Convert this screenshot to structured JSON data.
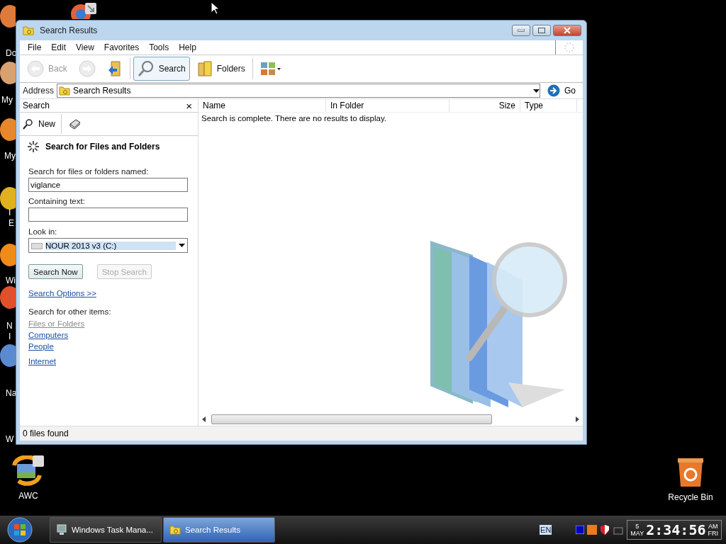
{
  "desktop": {
    "left_labels": [
      {
        "label": "Do"
      },
      {
        "label": "My"
      },
      {
        "label": "My"
      },
      {
        "label": "I"
      },
      {
        "label": "E"
      },
      {
        "label": "Wi"
      },
      {
        "label": "N"
      },
      {
        "label": "I"
      },
      {
        "label": "Na"
      },
      {
        "label": "W"
      }
    ],
    "icons": [
      {
        "label": "AWC",
        "kind": "awc"
      },
      {
        "label": "Recycle Bin",
        "kind": "bin"
      }
    ]
  },
  "window": {
    "title": "Search Results",
    "menu": [
      "File",
      "Edit",
      "View",
      "Favorites",
      "Tools",
      "Help"
    ],
    "toolbar": [
      {
        "kind": "back",
        "label": "Back",
        "disabled": true,
        "selected": false
      },
      {
        "kind": "forward",
        "disabled": true,
        "selected": false
      },
      {
        "kind": "up",
        "disabled": false,
        "selected": false
      },
      {
        "kind": "search",
        "label": "Search",
        "disabled": false,
        "selected": true
      },
      {
        "kind": "folders",
        "label": "Folders",
        "disabled": false,
        "selected": false
      },
      {
        "kind": "views",
        "disabled": false,
        "selected": false
      }
    ],
    "address": {
      "label": "Address",
      "value": "Search Results",
      "go": "Go"
    },
    "search_pane": {
      "title": "Search",
      "close": "×",
      "new": "New",
      "heading": "Search for Files and Folders",
      "name_label": "Search for files or folders named:",
      "name_value": "viglance",
      "text_label": "Containing text:",
      "look_label": "Look in:",
      "look_value": "NOUR 2013 v3 (C:)",
      "buttons": [
        {
          "label": "Search Now",
          "disabled": false
        },
        {
          "label": "Stop Search",
          "disabled": true
        }
      ],
      "options_link": "Search Options  >>",
      "other_label": "Search for other items:",
      "other_links": [
        {
          "label": "Files or Folders",
          "disabled": true
        },
        {
          "label": "Computers",
          "disabled": false
        },
        {
          "label": "People",
          "disabled": false
        },
        {
          "label": "Internet",
          "disabled": false
        }
      ]
    },
    "columns": [
      "Name",
      "In Folder",
      "Size",
      "Type"
    ],
    "message": "Search is complete. There are no results to display.",
    "status_bar": "0 files found"
  },
  "taskbar": {
    "buttons": [
      {
        "label": "Windows Task Mana...",
        "kind": "monitor",
        "selected": false
      },
      {
        "label": "Search Results",
        "kind": "folder",
        "selected": true
      }
    ],
    "language": "EN",
    "clock": {
      "day": "5",
      "month": "MAY",
      "time": "2:34:56",
      "ampm": "AM",
      "weekday": "FRI"
    }
  }
}
